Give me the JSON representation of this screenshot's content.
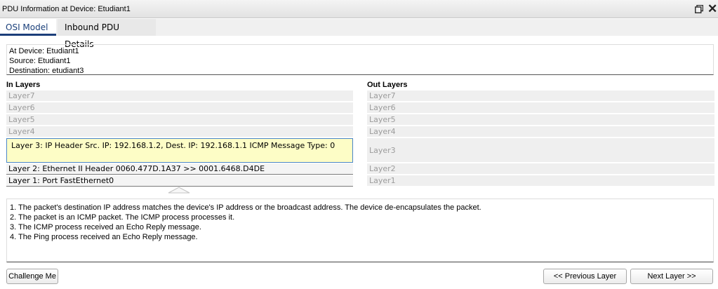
{
  "window": {
    "title": "PDU Information at Device: Etudiant1"
  },
  "tabs": [
    {
      "label": "OSI Model"
    },
    {
      "label": "Inbound PDU Details"
    }
  ],
  "info": {
    "device": "At Device: Etudiant1",
    "source": "Source: Etudiant1",
    "destination": "Destination: etudiant3"
  },
  "in_layers": {
    "title": "In Layers",
    "items": [
      {
        "label": "Layer7"
      },
      {
        "label": "Layer6"
      },
      {
        "label": "Layer5"
      },
      {
        "label": "Layer4"
      },
      {
        "label": "Layer 3: IP Header Src. IP: 192.168.1.2, Dest. IP: 192.168.1.1 ICMP Message Type: 0"
      },
      {
        "label": "Layer 2: Ethernet II Header 0060.477D.1A37 >> 0001.6468.D4DE"
      },
      {
        "label": "Layer 1: Port FastEthernet0"
      }
    ]
  },
  "out_layers": {
    "title": "Out Layers",
    "items": [
      {
        "label": "Layer7"
      },
      {
        "label": "Layer6"
      },
      {
        "label": "Layer5"
      },
      {
        "label": "Layer4"
      },
      {
        "label": "Layer3"
      },
      {
        "label": "Layer2"
      },
      {
        "label": "Layer1"
      }
    ]
  },
  "description": [
    "1. The packet's destination IP address matches the device's IP address or the broadcast address. The device de-encapsulates the packet.",
    "2. The packet is an ICMP packet. The ICMP process processes it.",
    "3. The ICMP process received an Echo Reply message.",
    "4. The Ping process received an Echo Reply message."
  ],
  "buttons": {
    "challenge": "Challenge Me",
    "previous": "<< Previous Layer",
    "next": "Next Layer >>"
  }
}
